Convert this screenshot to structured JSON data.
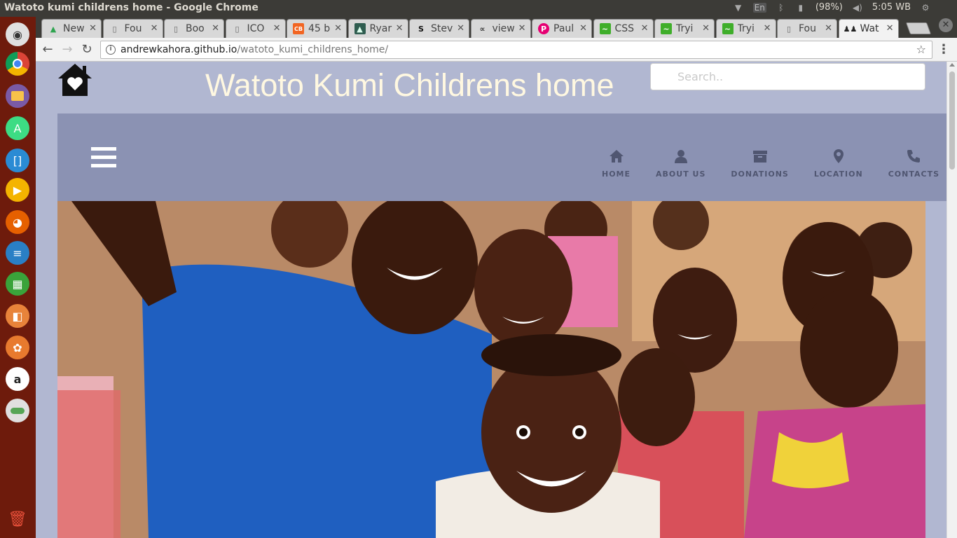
{
  "window": {
    "title": "Watoto kumi childrens home - Google Chrome"
  },
  "indicators": {
    "language": "En",
    "battery": "(98%)",
    "time": "5:05 WB"
  },
  "tabs": [
    {
      "label": "New",
      "icon": "google-drive-icon",
      "color": "#2ea44f"
    },
    {
      "label": "Fou",
      "icon": "document-icon",
      "color": "#666666"
    },
    {
      "label": "Boo",
      "icon": "document-icon",
      "color": "#666666"
    },
    {
      "label": "ICO",
      "icon": "document-icon",
      "color": "#666666"
    },
    {
      "label": "45 b",
      "icon": "codepen-icon",
      "color": "#f26522"
    },
    {
      "label": "Ryar",
      "icon": "mountain-icon",
      "color": "#2f5d50"
    },
    {
      "label": "Stev",
      "icon": "s-icon",
      "color": "#111111"
    },
    {
      "label": "view",
      "icon": "view-icon",
      "color": "#333333"
    },
    {
      "label": "Paul",
      "icon": "pinterest-icon",
      "color": "#e60073"
    },
    {
      "label": "CSS",
      "icon": "css-icon",
      "color": "#3fae2a"
    },
    {
      "label": "Tryi",
      "icon": "tryit-icon",
      "color": "#3fae2a"
    },
    {
      "label": "Tryi",
      "icon": "tryit-icon",
      "color": "#3fae2a"
    },
    {
      "label": "Fou",
      "icon": "document-icon",
      "color": "#666666"
    },
    {
      "label": "Wat",
      "icon": "people-icon",
      "color": "#222222",
      "active": true
    }
  ],
  "address": {
    "host": "andrewkahora.github.io",
    "path": "/watoto_kumi_childrens_home/"
  },
  "site": {
    "title": "Watoto Kumi Childrens home",
    "search_placeholder": "Search..",
    "nav": [
      {
        "label": "HOME",
        "icon": "home-icon"
      },
      {
        "label": "ABOUT US",
        "icon": "user-icon"
      },
      {
        "label": "DONATIONS",
        "icon": "archive-icon"
      },
      {
        "label": "LOCATION",
        "icon": "map-marker-icon"
      },
      {
        "label": "CONTACTS",
        "icon": "phone-icon"
      }
    ],
    "colors": {
      "page_bg": "#b1b7d1",
      "navbar_bg": "#8b92b3",
      "title": "#fff8e1",
      "nav_text": "#505671"
    }
  }
}
